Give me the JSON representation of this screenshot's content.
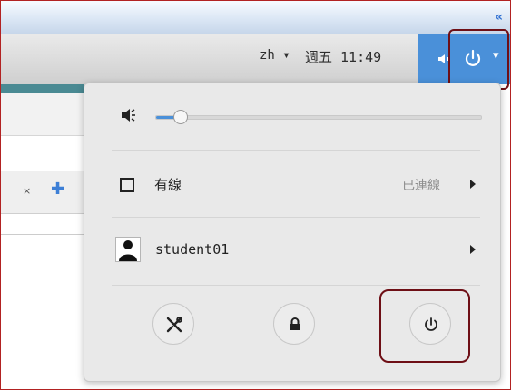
{
  "top_strip": {
    "collapse_glyph": "«"
  },
  "topbar": {
    "language": "zh ▾",
    "clock": "週五 11:49",
    "volume_icon": "speaker-icon",
    "power_icon": "power-icon",
    "dropdown_glyph": "▾",
    "accent_color": "#4a90d9"
  },
  "background_window": {
    "tab_close": "×",
    "tab_add": "✚"
  },
  "system_menu": {
    "volume": {
      "icon": "speaker-icon",
      "level": 0.06
    },
    "wired": {
      "label": "有線",
      "status": "已連線",
      "icon": "network-wired-icon"
    },
    "user": {
      "label": "student01",
      "icon": "avatar-icon"
    },
    "buttons": [
      {
        "name": "settings",
        "icon": "tools-icon"
      },
      {
        "name": "lock",
        "icon": "lock-icon"
      },
      {
        "name": "power-off",
        "icon": "power-icon"
      }
    ]
  },
  "annotations": {
    "highlight_color": "#6e0f16"
  }
}
